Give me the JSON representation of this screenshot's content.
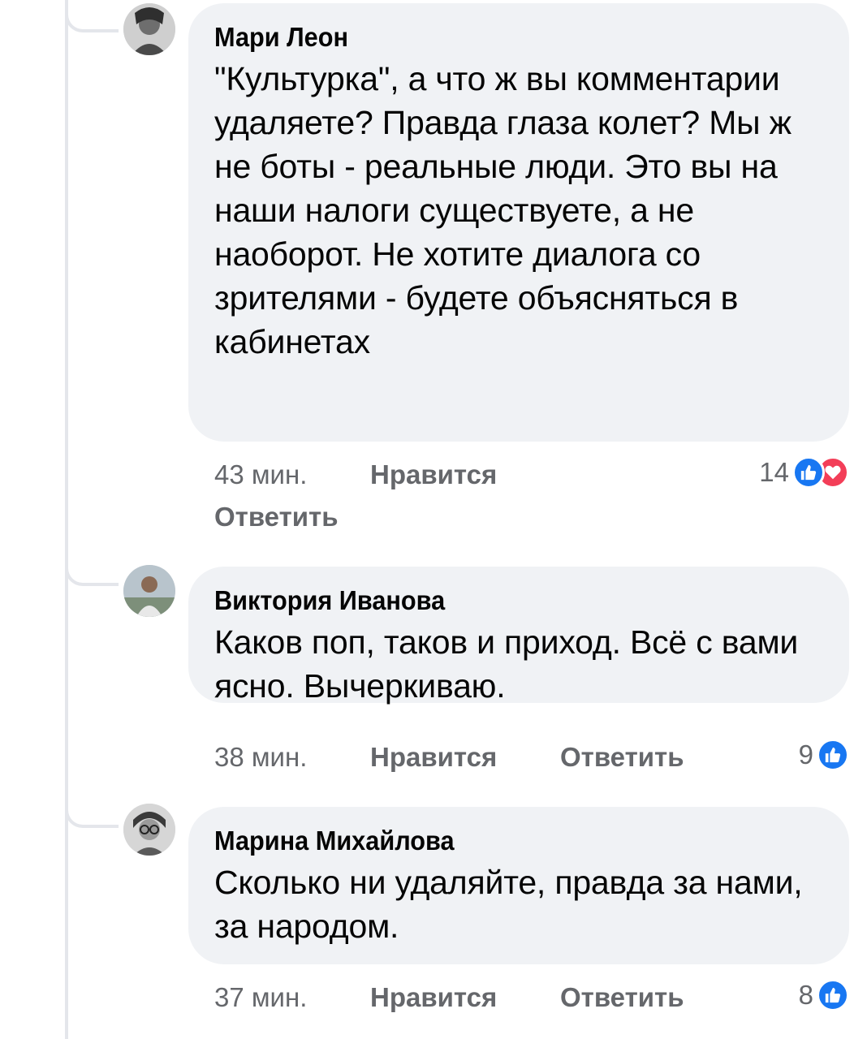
{
  "comments": [
    {
      "author": "Мари Леон",
      "text": "\"Культурка\", а что ж вы комментарии удаляете? Правда глаза колет? Мы ж не боты - реальные люди. Это вы на наши налоги существуете, а не наоборот. Не хотите диалога со зрителями - будете объясняться в кабинетах",
      "time": "43 мин.",
      "like_label": "Нравится",
      "reply_label": "Ответить",
      "reaction_count": "14",
      "reactions": [
        "like-icon",
        "love-icon"
      ]
    },
    {
      "author": "Виктория Иванова",
      "text": "Каков поп, таков и приход. Всё с вами ясно. Вычеркиваю.",
      "time": "38 мин.",
      "like_label": "Нравится",
      "reply_label": "Ответить",
      "reaction_count": "9",
      "reactions": [
        "like-icon"
      ]
    },
    {
      "author": "Марина Михайлова",
      "text": "Сколько ни удаляйте, правда за нами, за народом.",
      "time": "37 мин.",
      "like_label": "Нравится",
      "reply_label": "Ответить",
      "reaction_count": "8",
      "reactions": [
        "like-icon"
      ]
    }
  ],
  "colors": {
    "bubble": "#f0f2f5",
    "meta": "#65676b",
    "like": "#1877f2",
    "love": "#f33e58",
    "thread_line": "#e4e6eb"
  }
}
